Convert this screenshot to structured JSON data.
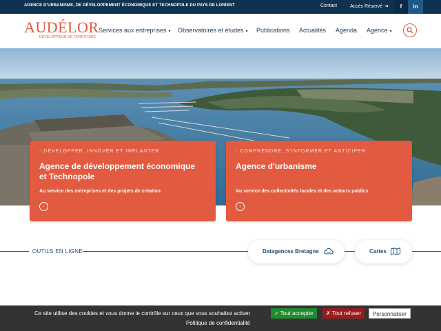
{
  "topbar": {
    "tagline": "AGENCE D'URBANISME, DE DÉVELOPPEMENT ÉCONOMIQUE ET TECHNOPOLE DU PAYS DE LORIENT",
    "contact": "Contact",
    "access": "Accès Réservé",
    "facebook": "f",
    "linkedin": "in"
  },
  "logo": {
    "name": "AUDÉLOR",
    "subtitle": "DÉVELOPPEUR DE TERRITOIRE"
  },
  "nav": {
    "items": [
      {
        "label": "Services aux entreprises",
        "dropdown": true
      },
      {
        "label": "Observatoires et études",
        "dropdown": true
      },
      {
        "label": "Publications",
        "dropdown": false
      },
      {
        "label": "Actualités",
        "dropdown": false
      },
      {
        "label": "Agenda",
        "dropdown": false
      },
      {
        "label": "Agence",
        "dropdown": true
      }
    ]
  },
  "cards": [
    {
      "kicker": "- DÉVELOPPER, INNOVER ET IMPLANTER",
      "title": "Agence de développement économique et Technopole",
      "desc": "Au service des entreprises et des projets de création"
    },
    {
      "kicker": "- COMPRENDRE, S'INFORMER ET ANTICIPER",
      "title": "Agence d'urbanisme",
      "desc": "Au service des collectivités locales et des acteurs publics"
    }
  ],
  "outils": {
    "title": "OUTILS EN LIGNE",
    "links": [
      {
        "label": "Datagences Bretagne",
        "icon": "cloud-icon"
      },
      {
        "label": "Cartes",
        "icon": "map-icon"
      }
    ]
  },
  "cookie": {
    "message": "Ce site utilise des cookies et vous donne le contrôle sur ceux que vous souhaitez activer",
    "accept": "✓ Tout accepter",
    "refuse": "✗ Tout refuser",
    "customize": "Personnaliser",
    "policy": "Politique de confidentialité"
  },
  "colors": {
    "brand": "#e2573e",
    "navy": "#0f3251",
    "accept": "#1f8a2f",
    "refuse": "#9a1c1c"
  }
}
